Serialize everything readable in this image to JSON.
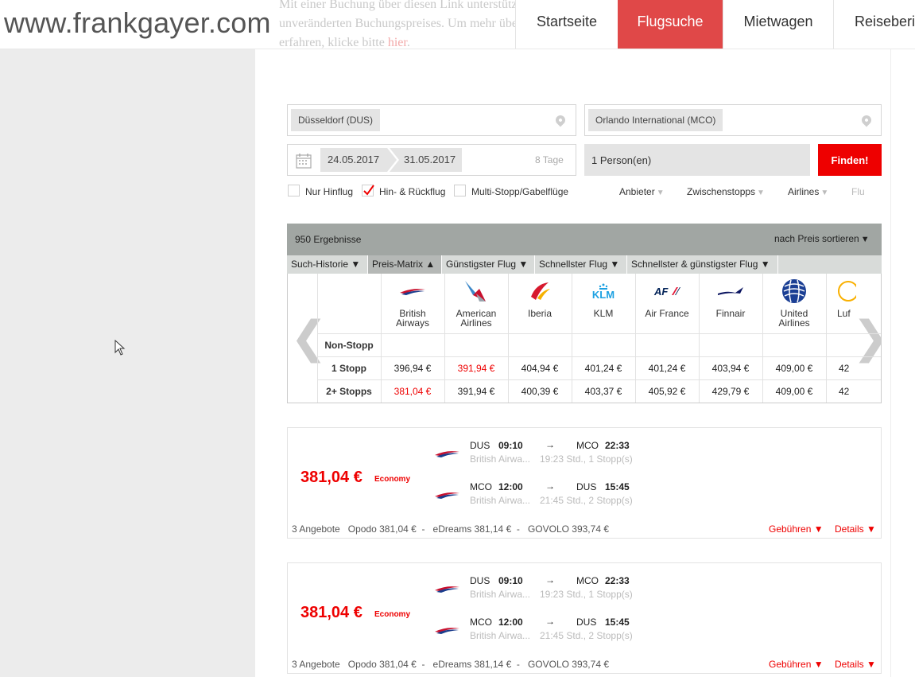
{
  "intro": {
    "line1": "Mit einer Buchung über diesen Link unterstützt Du unsere Seite mit einem kleinen Teil des",
    "line2": "unveränderten Buchungspreises. Um mehr über das Refinanzierungsmodell von uns zu",
    "line3_prefix": "erfahren, klicke bitte ",
    "line3_link": "hier",
    "line3_suffix": "."
  },
  "header": {
    "logo": "www.frankgayer.com",
    "nav": [
      "Startseite",
      "Flugsuche",
      "Mietwagen",
      "Reiseberic"
    ],
    "active_nav": "Flugsuche"
  },
  "search": {
    "origin": "Düsseldorf (DUS)",
    "destination": "Orlando International (MCO)",
    "date_out": "24.05.2017",
    "date_back": "31.05.2017",
    "duration": "8 Tage",
    "passengers": "1 Person(en)",
    "find_button": "Finden!",
    "trip_types": [
      {
        "label": "Nur Hinflug",
        "checked": false
      },
      {
        "label": "Hin- & Rückflug",
        "checked": true
      },
      {
        "label": "Multi-Stopp/Gabelflüge",
        "checked": false
      }
    ],
    "filters": [
      "Anbieter",
      "Zwischenstopps",
      "Airlines",
      "Flu"
    ]
  },
  "matrix": {
    "result_count": "950 Ergebnisse",
    "sort_label": "nach Preis sortieren",
    "tabs": [
      "Such-Historie",
      "Preis-Matrix",
      "Günstigster Flug",
      "Schnellster Flug",
      "Schnellster & günstigster Flug"
    ],
    "active_tab": "Preis-Matrix",
    "airlines": [
      {
        "name": "British Airways",
        "l1": "British",
        "l2": "Airways",
        "logo": "british-airways-logo"
      },
      {
        "name": "American Airlines",
        "l1": "American",
        "l2": "Airlines",
        "logo": "american-airlines-logo"
      },
      {
        "name": "Iberia",
        "l1": "Iberia",
        "l2": "",
        "logo": "iberia-logo"
      },
      {
        "name": "KLM",
        "l1": "KLM",
        "l2": "",
        "logo": "klm-logo"
      },
      {
        "name": "Air France",
        "l1": "Air France",
        "l2": "",
        "logo": "air-france-logo"
      },
      {
        "name": "Finnair",
        "l1": "Finnair",
        "l2": "",
        "logo": "finnair-logo"
      },
      {
        "name": "United Airlines",
        "l1": "United",
        "l2": "Airlines",
        "logo": "united-airlines-logo"
      },
      {
        "name": "Luf",
        "l1": "Luf",
        "l2": "",
        "logo": "lufthansa-logo"
      }
    ],
    "rows": [
      {
        "label": "Non-Stopp",
        "prices": [
          "",
          "",
          "",
          "",
          "",
          "",
          "",
          ""
        ]
      },
      {
        "label": "1 Stopp",
        "prices": [
          "396,94 €",
          "391,94 €",
          "404,94 €",
          "401,24 €",
          "401,24 €",
          "403,94 €",
          "409,00 €",
          "42"
        ],
        "highlight": 1
      },
      {
        "label": "2+ Stopps",
        "prices": [
          "381,04 €",
          "391,94 €",
          "400,39 €",
          "403,37 €",
          "405,92 €",
          "429,79 €",
          "409,00 €",
          "42"
        ],
        "highlight": 0
      }
    ]
  },
  "results": [
    {
      "price": "381,04 €",
      "class": "Economy",
      "legs": [
        {
          "from": "DUS",
          "dep": "09:10",
          "to": "MCO",
          "arr": "22:33",
          "airline": "British Airwa...",
          "info": "19:23 Std., 1 Stopp(s)"
        },
        {
          "from": "MCO",
          "dep": "12:00",
          "to": "DUS",
          "arr": "15:45",
          "airline": "British Airwa...",
          "info": "21:45 Std., 2 Stopp(s)"
        }
      ],
      "offers_count": "3 Angebote",
      "offers": [
        "Opodo 381,04 €",
        "eDreams 381,14 €",
        "GOVOLO 393,74 €"
      ],
      "fees": "Gebühren",
      "details": "Details"
    },
    {
      "price": "381,04 €",
      "class": "Economy",
      "legs": [
        {
          "from": "DUS",
          "dep": "09:10",
          "to": "MCO",
          "arr": "22:33",
          "airline": "British Airwa...",
          "info": "19:23 Std., 1 Stopp(s)"
        },
        {
          "from": "MCO",
          "dep": "12:00",
          "to": "DUS",
          "arr": "15:45",
          "airline": "British Airwa...",
          "info": "21:45 Std., 2 Stopp(s)"
        }
      ],
      "offers_count": "3 Angebote",
      "offers": [
        "Opodo 381,04 €",
        "eDreams 381,14 €",
        "GOVOLO 393,74 €"
      ],
      "fees": "Gebühren",
      "details": "Details"
    }
  ],
  "glyphs": {
    "arrow": "→",
    "down": "▼",
    "up": "▲",
    "sep": "-",
    "prev": "❮",
    "next": "❯"
  },
  "colors": {
    "accent": "#e04848",
    "price_red": "#ee0000",
    "header_gray": "#a1a6a3"
  }
}
